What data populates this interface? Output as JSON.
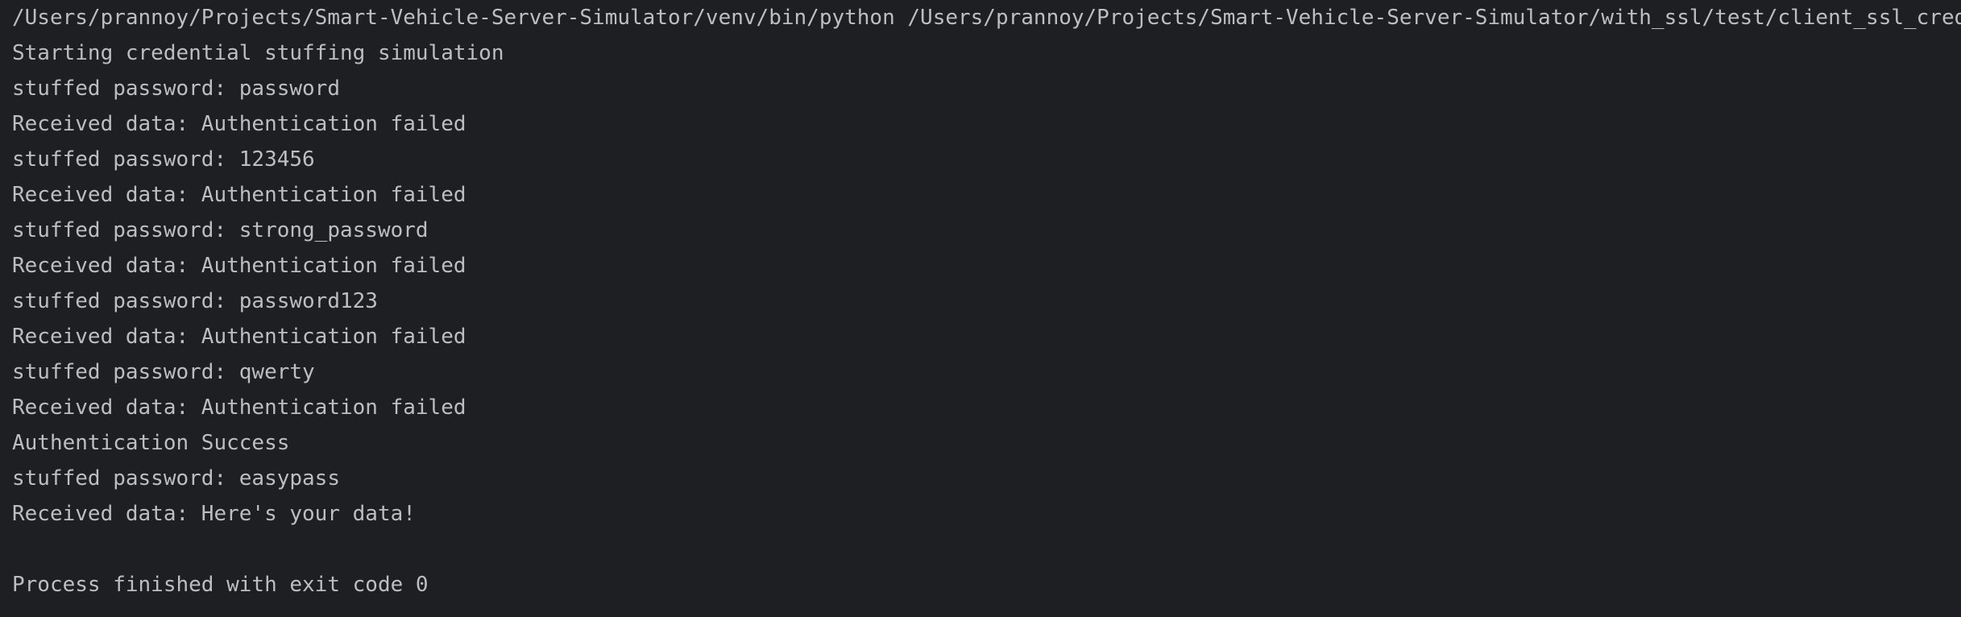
{
  "console": {
    "command_line": "/Users/prannoy/Projects/Smart-Vehicle-Server-Simulator/venv/bin/python /Users/prannoy/Projects/Smart-Vehicle-Server-Simulator/with_ssl/test/client_ssl_cred",
    "lines": [
      "Starting credential stuffing simulation",
      "stuffed password: password",
      "Received data: Authentication failed",
      "stuffed password: 123456",
      "Received data: Authentication failed",
      "stuffed password: strong_password",
      "Received data: Authentication failed",
      "stuffed password: password123",
      "Received data: Authentication failed",
      "stuffed password: qwerty",
      "Received data: Authentication failed",
      "Authentication Success",
      "stuffed password: easypass",
      "Received data: Here's your data!",
      "",
      "Process finished with exit code 0"
    ]
  }
}
